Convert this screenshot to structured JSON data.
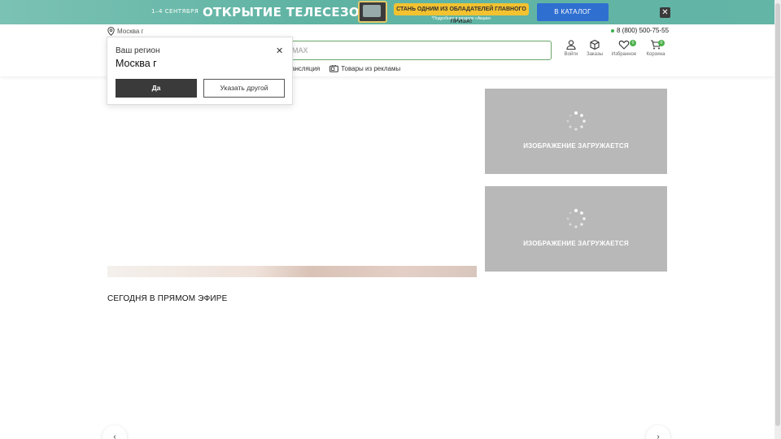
{
  "promo": {
    "date": "1–4 СЕНТЯБРЯ",
    "title": "ОТКРЫТИЕ ТЕЛЕСЕЗОНА",
    "pill": "СТАНЬ ОДНИМ ИЗ ОБЛАДАТЕЛЕЙ ГЛАВНОГО ПРИЗА!",
    "note": "*Подробнее в разделе «Акции»",
    "button": "В КАТАЛОГ"
  },
  "header": {
    "city": "Москва г",
    "phone": "8 (800) 500-75-55",
    "search_text": "MAX",
    "icons": [
      {
        "label": "Войти",
        "icon": "user-icon"
      },
      {
        "label": "Заказы",
        "icon": "box-icon"
      },
      {
        "label": "Избранное",
        "icon": "heart-icon",
        "badge": "0"
      },
      {
        "label": "Корзина",
        "icon": "cart-icon",
        "badge": "0"
      }
    ],
    "nav": [
      "ансляция",
      "Товары из рекламы"
    ]
  },
  "popup": {
    "label": "Ваш регион",
    "city": "Москва г",
    "yes": "Да",
    "other": "Указать другой"
  },
  "main": {
    "placeholder_text": "ИЗОБРАЖЕНИЕ ЗАГРУЖАЕТСЯ",
    "section_title": "СЕГОДНЯ В ПРЯМОМ ЭФИРЕ"
  },
  "colors": {
    "accent_green": "#4bb04a",
    "promo_bg": "#63b5a6",
    "button_blue": "#2f6fd0",
    "dark": "#3a3a3a"
  }
}
